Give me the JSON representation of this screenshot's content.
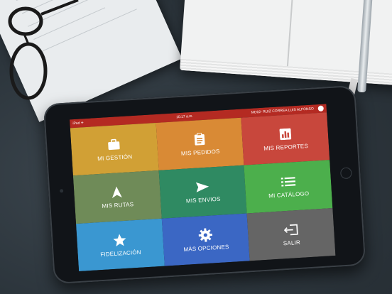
{
  "statusbar": {
    "carrier": "iPad ✈",
    "time": "10:17 a.m.",
    "user": "MD02- RUIZ CORREA LUIS ALFONSO"
  },
  "tiles": [
    {
      "label": "MI GESTIÓN",
      "icon": "briefcase-icon",
      "color": "#d1a035"
    },
    {
      "label": "MIS PEDIDOS",
      "icon": "clipboard-icon",
      "color": "#d98a35"
    },
    {
      "label": "MIS REPORTES",
      "icon": "bar-chart-icon",
      "color": "#c8473c"
    },
    {
      "label": "MIS RUTAS",
      "icon": "navigation-arrow-icon",
      "color": "#6f8b58"
    },
    {
      "label": "MIS ENVIOS",
      "icon": "send-icon",
      "color": "#2f8a62"
    },
    {
      "label": "MI CATÁLOGO",
      "icon": "list-icon",
      "color": "#4caf4c"
    },
    {
      "label": "FIDELIZACIÓN",
      "icon": "star-icon",
      "color": "#3a97d1"
    },
    {
      "label": "MÁS OPCIONES",
      "icon": "gear-icon",
      "color": "#3b67c4"
    },
    {
      "label": "SALIR",
      "icon": "logout-icon",
      "color": "#656565"
    }
  ]
}
